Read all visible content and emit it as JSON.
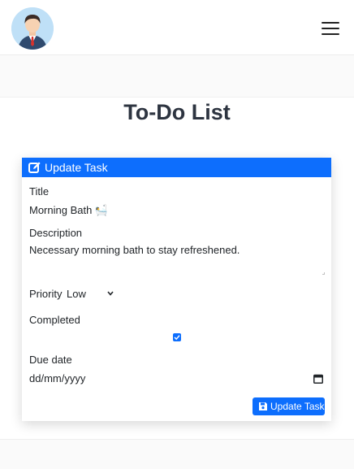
{
  "header": {
    "avatar_icon": "user-avatar-icon",
    "menu_icon": "hamburger-menu-icon"
  },
  "page": {
    "title": "To-Do List"
  },
  "card": {
    "header_label": "Update Task",
    "header_icon": "edit-icon",
    "title_label": "Title",
    "title_value": "Morning Bath 🛀",
    "description_label": "Description",
    "description_value": "Necessary morning bath to stay refreshened.",
    "priority_label": "Priority",
    "priority_value": "Low",
    "completed_label": "Completed",
    "completed": true,
    "due_date_label": "Due date",
    "due_date_placeholder": "dd/mm/yyyy",
    "submit_label": "Update Task",
    "submit_icon": "save-icon"
  },
  "colors": {
    "accent": "#0d6efd",
    "title": "#2d3440"
  }
}
